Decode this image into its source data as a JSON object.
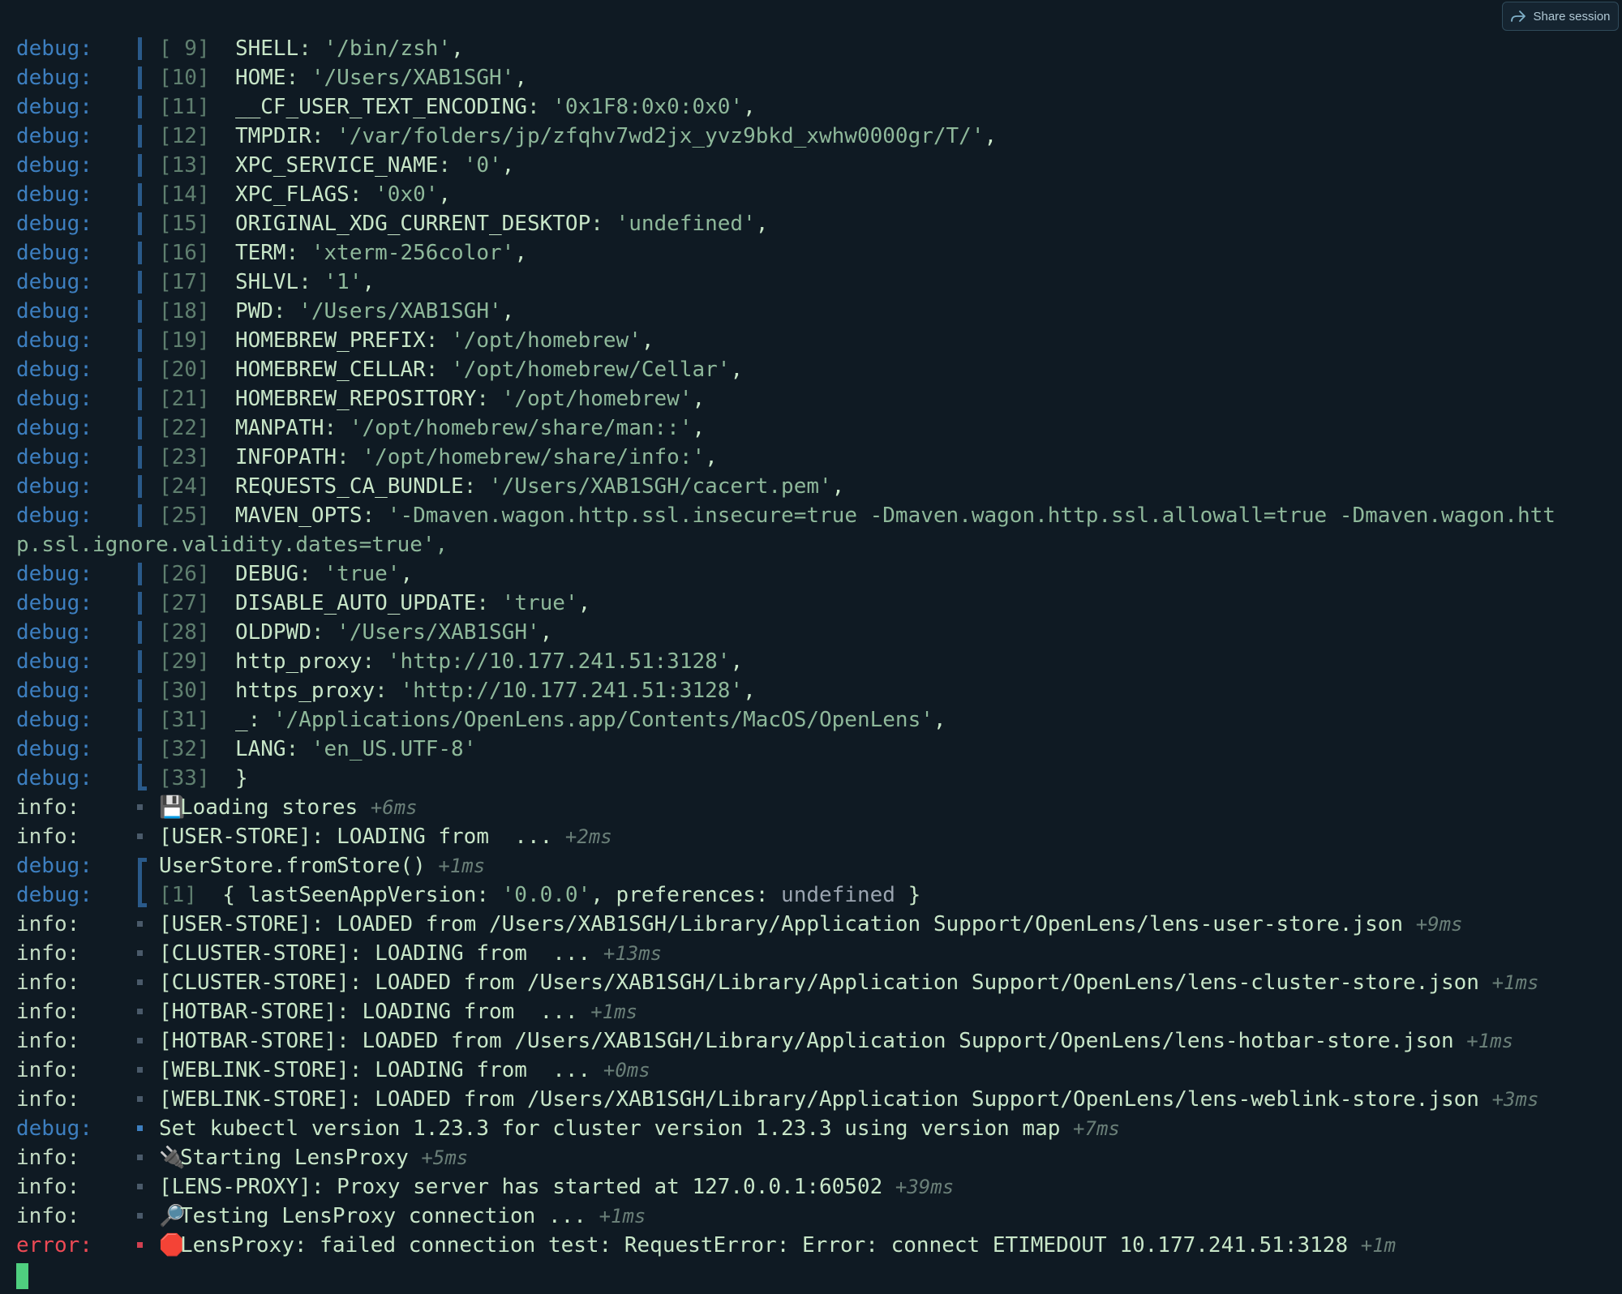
{
  "header": {
    "share_label": "Share session"
  },
  "colors": {
    "debug": "#3d7fc0",
    "info": "#c4dcc4",
    "error": "#ee4a55",
    "bar": "#2a5a8a",
    "dot_info": "#4a5a6a",
    "dot_debug": "#3d7fc0",
    "dot_error": "#d04050"
  },
  "wrapped_continuation": "p.ssl.ignore.validity.dates=true',",
  "lines": [
    {
      "level": "debug",
      "gutter": "bar",
      "idx": "[ 9]",
      "key": "SHELL",
      "value": "'/bin/zsh'",
      "tail": ","
    },
    {
      "level": "debug",
      "gutter": "bar",
      "idx": "[10]",
      "key": "HOME",
      "value": "'/Users/XAB1SGH'",
      "tail": ","
    },
    {
      "level": "debug",
      "gutter": "bar",
      "idx": "[11]",
      "key": "__CF_USER_TEXT_ENCODING",
      "value": "'0x1F8:0x0:0x0'",
      "tail": ","
    },
    {
      "level": "debug",
      "gutter": "bar",
      "idx": "[12]",
      "key": "TMPDIR",
      "value": "'/var/folders/jp/zfqhv7wd2jx_yvz9bkd_xwhw0000gr/T/'",
      "tail": ","
    },
    {
      "level": "debug",
      "gutter": "bar",
      "idx": "[13]",
      "key": "XPC_SERVICE_NAME",
      "value": "'0'",
      "tail": ","
    },
    {
      "level": "debug",
      "gutter": "bar",
      "idx": "[14]",
      "key": "XPC_FLAGS",
      "value": "'0x0'",
      "tail": ","
    },
    {
      "level": "debug",
      "gutter": "bar",
      "idx": "[15]",
      "key": "ORIGINAL_XDG_CURRENT_DESKTOP",
      "value": "'undefined'",
      "tail": ","
    },
    {
      "level": "debug",
      "gutter": "bar",
      "idx": "[16]",
      "key": "TERM",
      "value": "'xterm-256color'",
      "tail": ","
    },
    {
      "level": "debug",
      "gutter": "bar",
      "idx": "[17]",
      "key": "SHLVL",
      "value": "'1'",
      "tail": ","
    },
    {
      "level": "debug",
      "gutter": "bar",
      "idx": "[18]",
      "key": "PWD",
      "value": "'/Users/XAB1SGH'",
      "tail": ","
    },
    {
      "level": "debug",
      "gutter": "bar",
      "idx": "[19]",
      "key": "HOMEBREW_PREFIX",
      "value": "'/opt/homebrew'",
      "tail": ","
    },
    {
      "level": "debug",
      "gutter": "bar",
      "idx": "[20]",
      "key": "HOMEBREW_CELLAR",
      "value": "'/opt/homebrew/Cellar'",
      "tail": ","
    },
    {
      "level": "debug",
      "gutter": "bar",
      "idx": "[21]",
      "key": "HOMEBREW_REPOSITORY",
      "value": "'/opt/homebrew'",
      "tail": ","
    },
    {
      "level": "debug",
      "gutter": "bar",
      "idx": "[22]",
      "key": "MANPATH",
      "value": "'/opt/homebrew/share/man::'",
      "tail": ","
    },
    {
      "level": "debug",
      "gutter": "bar",
      "idx": "[23]",
      "key": "INFOPATH",
      "value": "'/opt/homebrew/share/info:'",
      "tail": ","
    },
    {
      "level": "debug",
      "gutter": "bar",
      "idx": "[24]",
      "key": "REQUESTS_CA_BUNDLE",
      "value": "'/Users/XAB1SGH/cacert.pem'",
      "tail": ","
    },
    {
      "level": "debug",
      "gutter": "bar",
      "idx": "[25]",
      "key": "MAVEN_OPTS",
      "value": "'-Dmaven.wagon.http.ssl.insecure=true -Dmaven.wagon.http.ssl.allowall=true -Dmaven.wagon.htt",
      "tail": ""
    },
    {
      "level": "debug",
      "gutter": "bar",
      "idx": "[26]",
      "key": "DEBUG",
      "value": "'true'",
      "tail": ","
    },
    {
      "level": "debug",
      "gutter": "bar",
      "idx": "[27]",
      "key": "DISABLE_AUTO_UPDATE",
      "value": "'true'",
      "tail": ","
    },
    {
      "level": "debug",
      "gutter": "bar",
      "idx": "[28]",
      "key": "OLDPWD",
      "value": "'/Users/XAB1SGH'",
      "tail": ","
    },
    {
      "level": "debug",
      "gutter": "bar",
      "idx": "[29]",
      "key": "http_proxy",
      "value": "'http://10.177.241.51:3128'",
      "tail": ","
    },
    {
      "level": "debug",
      "gutter": "bar",
      "idx": "[30]",
      "key": "https_proxy",
      "value": "'http://10.177.241.51:3128'",
      "tail": ","
    },
    {
      "level": "debug",
      "gutter": "bar",
      "idx": "[31]",
      "key": "_",
      "value": "'/Applications/OpenLens.app/Contents/MacOS/OpenLens'",
      "tail": ","
    },
    {
      "level": "debug",
      "gutter": "bar",
      "idx": "[32]",
      "key": "LANG",
      "value": "'en_US.UTF-8'",
      "tail": ""
    },
    {
      "level": "debug",
      "gutter": "bracket-bottom",
      "idx": "[33]",
      "text": "}"
    },
    {
      "level": "info",
      "gutter": "dot",
      "emoji": "💾",
      "text": "Loading stores",
      "dt": "+6ms"
    },
    {
      "level": "info",
      "gutter": "dot",
      "text": "[USER-STORE]: LOADING from  ...",
      "dt": "+2ms"
    },
    {
      "level": "debug",
      "gutter": "bracket-top",
      "text": "UserStore.fromStore()",
      "dt": "+1ms"
    },
    {
      "level": "debug",
      "gutter": "bracket-bottom",
      "idx": "[1]",
      "text": "{ lastSeenAppVersion: ",
      "value": "'0.0.0'",
      "text2": ", preferences: ",
      "undef": "undefined",
      "text3": " }"
    },
    {
      "level": "info",
      "gutter": "dot",
      "text": "[USER-STORE]: LOADED from /Users/XAB1SGH/Library/Application Support/OpenLens/lens-user-store.json",
      "dt": "+9ms"
    },
    {
      "level": "info",
      "gutter": "dot",
      "text": "[CLUSTER-STORE]: LOADING from  ...",
      "dt": "+13ms"
    },
    {
      "level": "info",
      "gutter": "dot",
      "text": "[CLUSTER-STORE]: LOADED from /Users/XAB1SGH/Library/Application Support/OpenLens/lens-cluster-store.json",
      "dt": "+1ms"
    },
    {
      "level": "info",
      "gutter": "dot",
      "text": "[HOTBAR-STORE]: LOADING from  ...",
      "dt": "+1ms"
    },
    {
      "level": "info",
      "gutter": "dot",
      "text": "[HOTBAR-STORE]: LOADED from /Users/XAB1SGH/Library/Application Support/OpenLens/lens-hotbar-store.json",
      "dt": "+1ms"
    },
    {
      "level": "info",
      "gutter": "dot",
      "text": "[WEBLINK-STORE]: LOADING from  ...",
      "dt": "+0ms"
    },
    {
      "level": "info",
      "gutter": "dot",
      "text": "[WEBLINK-STORE]: LOADED from /Users/XAB1SGH/Library/Application Support/OpenLens/lens-weblink-store.json",
      "dt": "+3ms"
    },
    {
      "level": "debug",
      "gutter": "dot",
      "text": "Set kubectl version 1.23.3 for cluster version 1.23.3 using version map",
      "dt": "+7ms"
    },
    {
      "level": "info",
      "gutter": "dot",
      "emoji": "🔌",
      "text": "Starting LensProxy",
      "dt": "+5ms"
    },
    {
      "level": "info",
      "gutter": "dot",
      "text": "[LENS-PROXY]: Proxy server has started at 127.0.0.1:60502",
      "dt": "+39ms"
    },
    {
      "level": "info",
      "gutter": "dot",
      "emoji": "🔎",
      "text": "Testing LensProxy connection ...",
      "dt": "+1ms"
    },
    {
      "level": "error",
      "gutter": "dot",
      "emoji": "🛑",
      "text": "LensProxy: failed connection test: RequestError: Error: connect ETIMEDOUT 10.177.241.51:3128",
      "dt": "+1m"
    }
  ]
}
